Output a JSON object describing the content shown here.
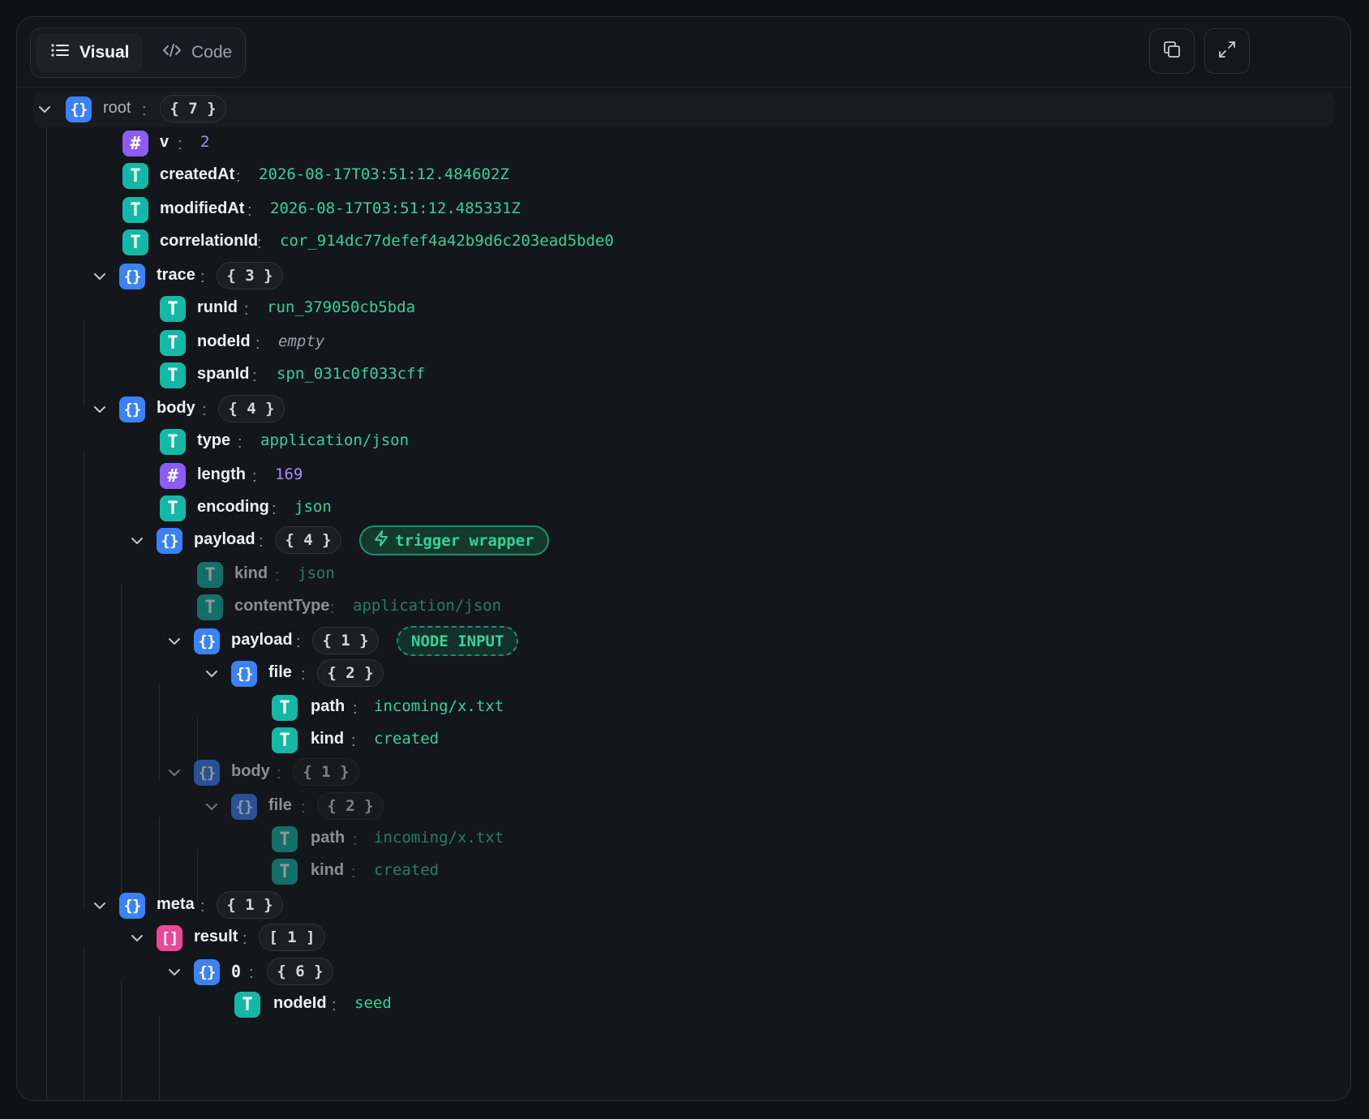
{
  "toolbar": {
    "tabs": [
      {
        "label": "Visual",
        "icon": "list-icon",
        "active": true
      },
      {
        "label": "Code",
        "icon": "code-icon",
        "active": false
      }
    ],
    "actions": [
      {
        "name": "copy",
        "icon": "copy-icon"
      },
      {
        "name": "expand",
        "icon": "expand-icon"
      }
    ]
  },
  "colors": {
    "object": "#3b82f6",
    "string": "#14b8a6",
    "number": "#8b5cf6",
    "array": "#ec4899",
    "string_value": "#34d399",
    "number_value": "#a78bfa"
  },
  "tree": {
    "sep": ":",
    "root": {
      "key": "root",
      "count": "{ 7 }"
    },
    "v": {
      "key": "v",
      "value": "2"
    },
    "createdAt": {
      "key": "createdAt",
      "value": "2026-08-17T03:51:12.484602Z"
    },
    "modifiedAt": {
      "key": "modifiedAt",
      "value": "2026-08-17T03:51:12.485331Z"
    },
    "correlationId": {
      "key": "correlationId",
      "value": "cor_914dc77defef4a42b9d6c203ead5bde0"
    },
    "trace": {
      "key": "trace",
      "count": "{ 3 }",
      "runId": {
        "key": "runId",
        "value": "run_379050cb5bda"
      },
      "nodeId": {
        "key": "nodeId",
        "value": "empty"
      },
      "spanId": {
        "key": "spanId",
        "value": "spn_031c0f033cff"
      }
    },
    "body": {
      "key": "body",
      "count": "{ 4 }",
      "type": {
        "key": "type",
        "value": "application/json"
      },
      "length": {
        "key": "length",
        "value": "169"
      },
      "encoding": {
        "key": "encoding",
        "value": "json"
      },
      "payload": {
        "key": "payload",
        "count": "{ 4 }",
        "badge": "trigger wrapper",
        "kind": {
          "key": "kind",
          "value": "json"
        },
        "contentType": {
          "key": "contentType",
          "value": "application/json"
        },
        "payload": {
          "key": "payload",
          "count": "{ 1 }",
          "badge": "NODE INPUT",
          "file": {
            "key": "file",
            "count": "{ 2 }",
            "path": {
              "key": "path",
              "value": "incoming/x.txt"
            },
            "kind": {
              "key": "kind",
              "value": "created"
            }
          }
        },
        "body": {
          "key": "body",
          "count": "{ 1 }",
          "file": {
            "key": "file",
            "count": "{ 2 }",
            "path": {
              "key": "path",
              "value": "incoming/x.txt"
            },
            "kind": {
              "key": "kind",
              "value": "created"
            }
          }
        }
      }
    },
    "meta": {
      "key": "meta",
      "count": "{ 1 }",
      "result": {
        "key": "result",
        "count": "[ 1 ]",
        "item0": {
          "key": "0",
          "count": "{ 6 }",
          "nodeId": {
            "key": "nodeId",
            "value": "seed"
          }
        }
      }
    }
  }
}
